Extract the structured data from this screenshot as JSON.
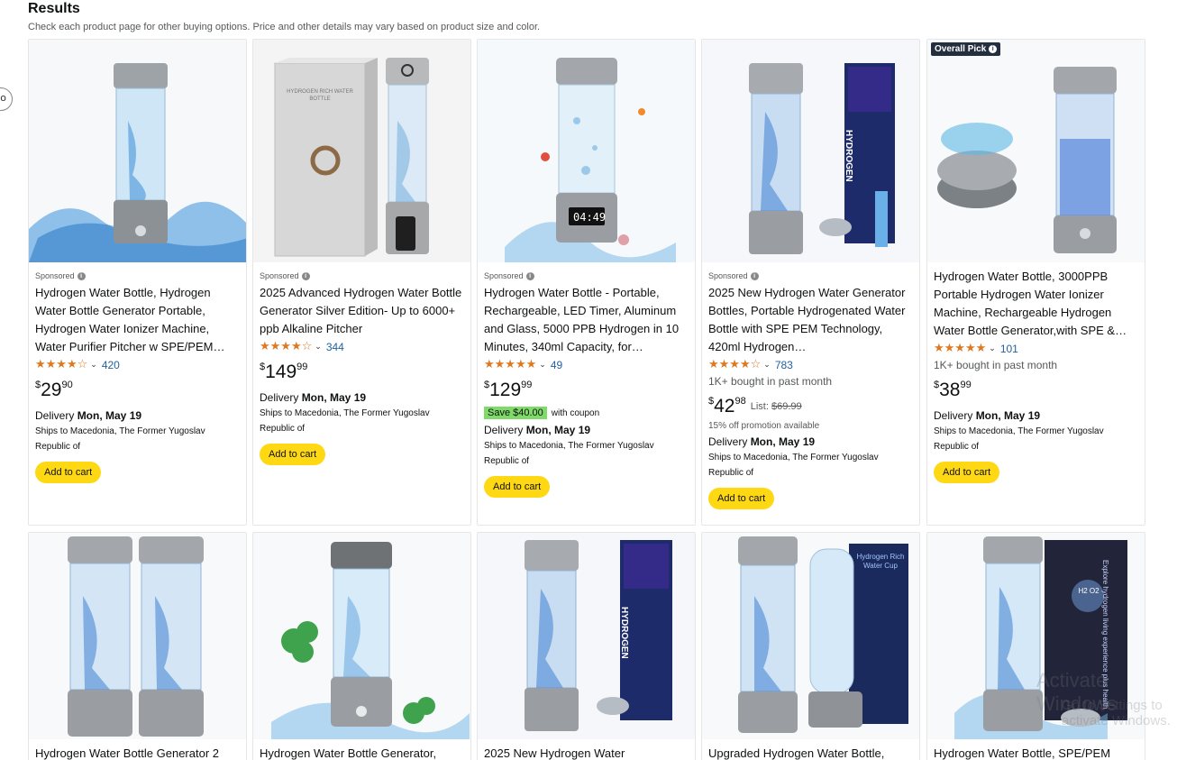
{
  "header": {
    "title": "Results",
    "subtitle": "Check each product page for other buying options. Price and other details may vary based on product size and color."
  },
  "side_tab_glyph": "o",
  "overall_badge": {
    "label": "Overall Pick"
  },
  "products": [
    {
      "sponsored": "Sponsored",
      "title": "Hydrogen Water Bottle, Hydrogen Water Bottle Generator Portable, Hydrogen Water Ionizer Machine, Water Purifier Pitcher w SPE/PEM…",
      "stars": "★★★★☆",
      "rating_count": "420",
      "price_symbol": "$",
      "price_whole": "29",
      "price_fraction": "90",
      "delivery_label": "Delivery",
      "delivery_date": "Mon, May 19",
      "ships_to": "Ships to Macedonia, The Former Yugoslav Republic of",
      "cart_label": "Add to cart"
    },
    {
      "sponsored": "Sponsored",
      "title": "2025 Advanced Hydrogen Water Bottle Generator Silver Edition- Up to 6000+ ppb Alkaline Pitcher",
      "stars": "★★★★☆",
      "rating_count": "344",
      "price_symbol": "$",
      "price_whole": "149",
      "price_fraction": "99",
      "delivery_label": "Delivery",
      "delivery_date": "Mon, May 19",
      "ships_to": "Ships to Macedonia, The Former Yugoslav Republic of",
      "cart_label": "Add to cart",
      "box_text": "HYDROGEN RICH WATER BOTTLE"
    },
    {
      "sponsored": "Sponsored",
      "title": "Hydrogen Water Bottle - Portable, Rechargeable, LED Timer, Aluminum and Glass, 5000 PPB Hydrogen in 10 Minutes, 340ml Capacity, for…",
      "stars": "★★★★★",
      "rating_count": "49",
      "price_symbol": "$",
      "price_whole": "129",
      "price_fraction": "99",
      "coupon_badge": "Save $40.00",
      "coupon_text": "with coupon",
      "delivery_label": "Delivery",
      "delivery_date": "Mon, May 19",
      "ships_to": "Ships to Macedonia, The Former Yugoslav Republic of",
      "cart_label": "Add to cart",
      "led_text": "04:49"
    },
    {
      "sponsored": "Sponsored",
      "title": "2025 New Hydrogen Water Generator Bottles, Portable Hydrogenated Water Bottle with SPE PEM Technology, 420ml Hydrogen…",
      "stars": "★★★★☆",
      "rating_count": "783",
      "bought": "1K+ bought in past month",
      "price_symbol": "$",
      "price_whole": "42",
      "price_fraction": "98",
      "list_label": "List:",
      "list_price": "$69.99",
      "promo": "15% off promotion available",
      "delivery_label": "Delivery",
      "delivery_date": "Mon, May 19",
      "ships_to": "Ships to Macedonia, The Former Yugoslav Republic of",
      "cart_label": "Add to cart",
      "box_text": "HYDROGEN"
    },
    {
      "title": "Hydrogen Water Bottle, 3000PPB Portable Hydrogen Water Ionizer Machine, Rechargeable Hydrogen Water Bottle Generator,with SPE &…",
      "stars": "★★★★★",
      "rating_count": "101",
      "bought": "1K+ bought in past month",
      "price_symbol": "$",
      "price_whole": "38",
      "price_fraction": "99",
      "delivery_label": "Delivery",
      "delivery_date": "Mon, May 19",
      "ships_to": "Ships to Macedonia, The Former Yugoslav Republic of",
      "cart_label": "Add to cart"
    },
    {
      "title": "Hydrogen Water Bottle Generator 2"
    },
    {
      "title": "Hydrogen Water Bottle Generator,"
    },
    {
      "title": "2025 New Hydrogen Water",
      "box_text": "HYDROGEN"
    },
    {
      "title": "Upgraded Hydrogen Water Bottle,",
      "box_text": "Hydrogen Rich Water Cup"
    },
    {
      "title": "Hydrogen Water Bottle, SPE/PEM",
      "box_text": "Explore hydrogen living experience plus health",
      "box_badge": "H2 O2"
    }
  ],
  "watermark": {
    "line1": "Activate Windows",
    "line2": "Go to Settings to activate Windows."
  },
  "colors": {
    "star": "#de7921",
    "link": "#2162a1",
    "cart": "#ffd814",
    "coupon": "#7fda69",
    "badge": "#232f3e"
  }
}
